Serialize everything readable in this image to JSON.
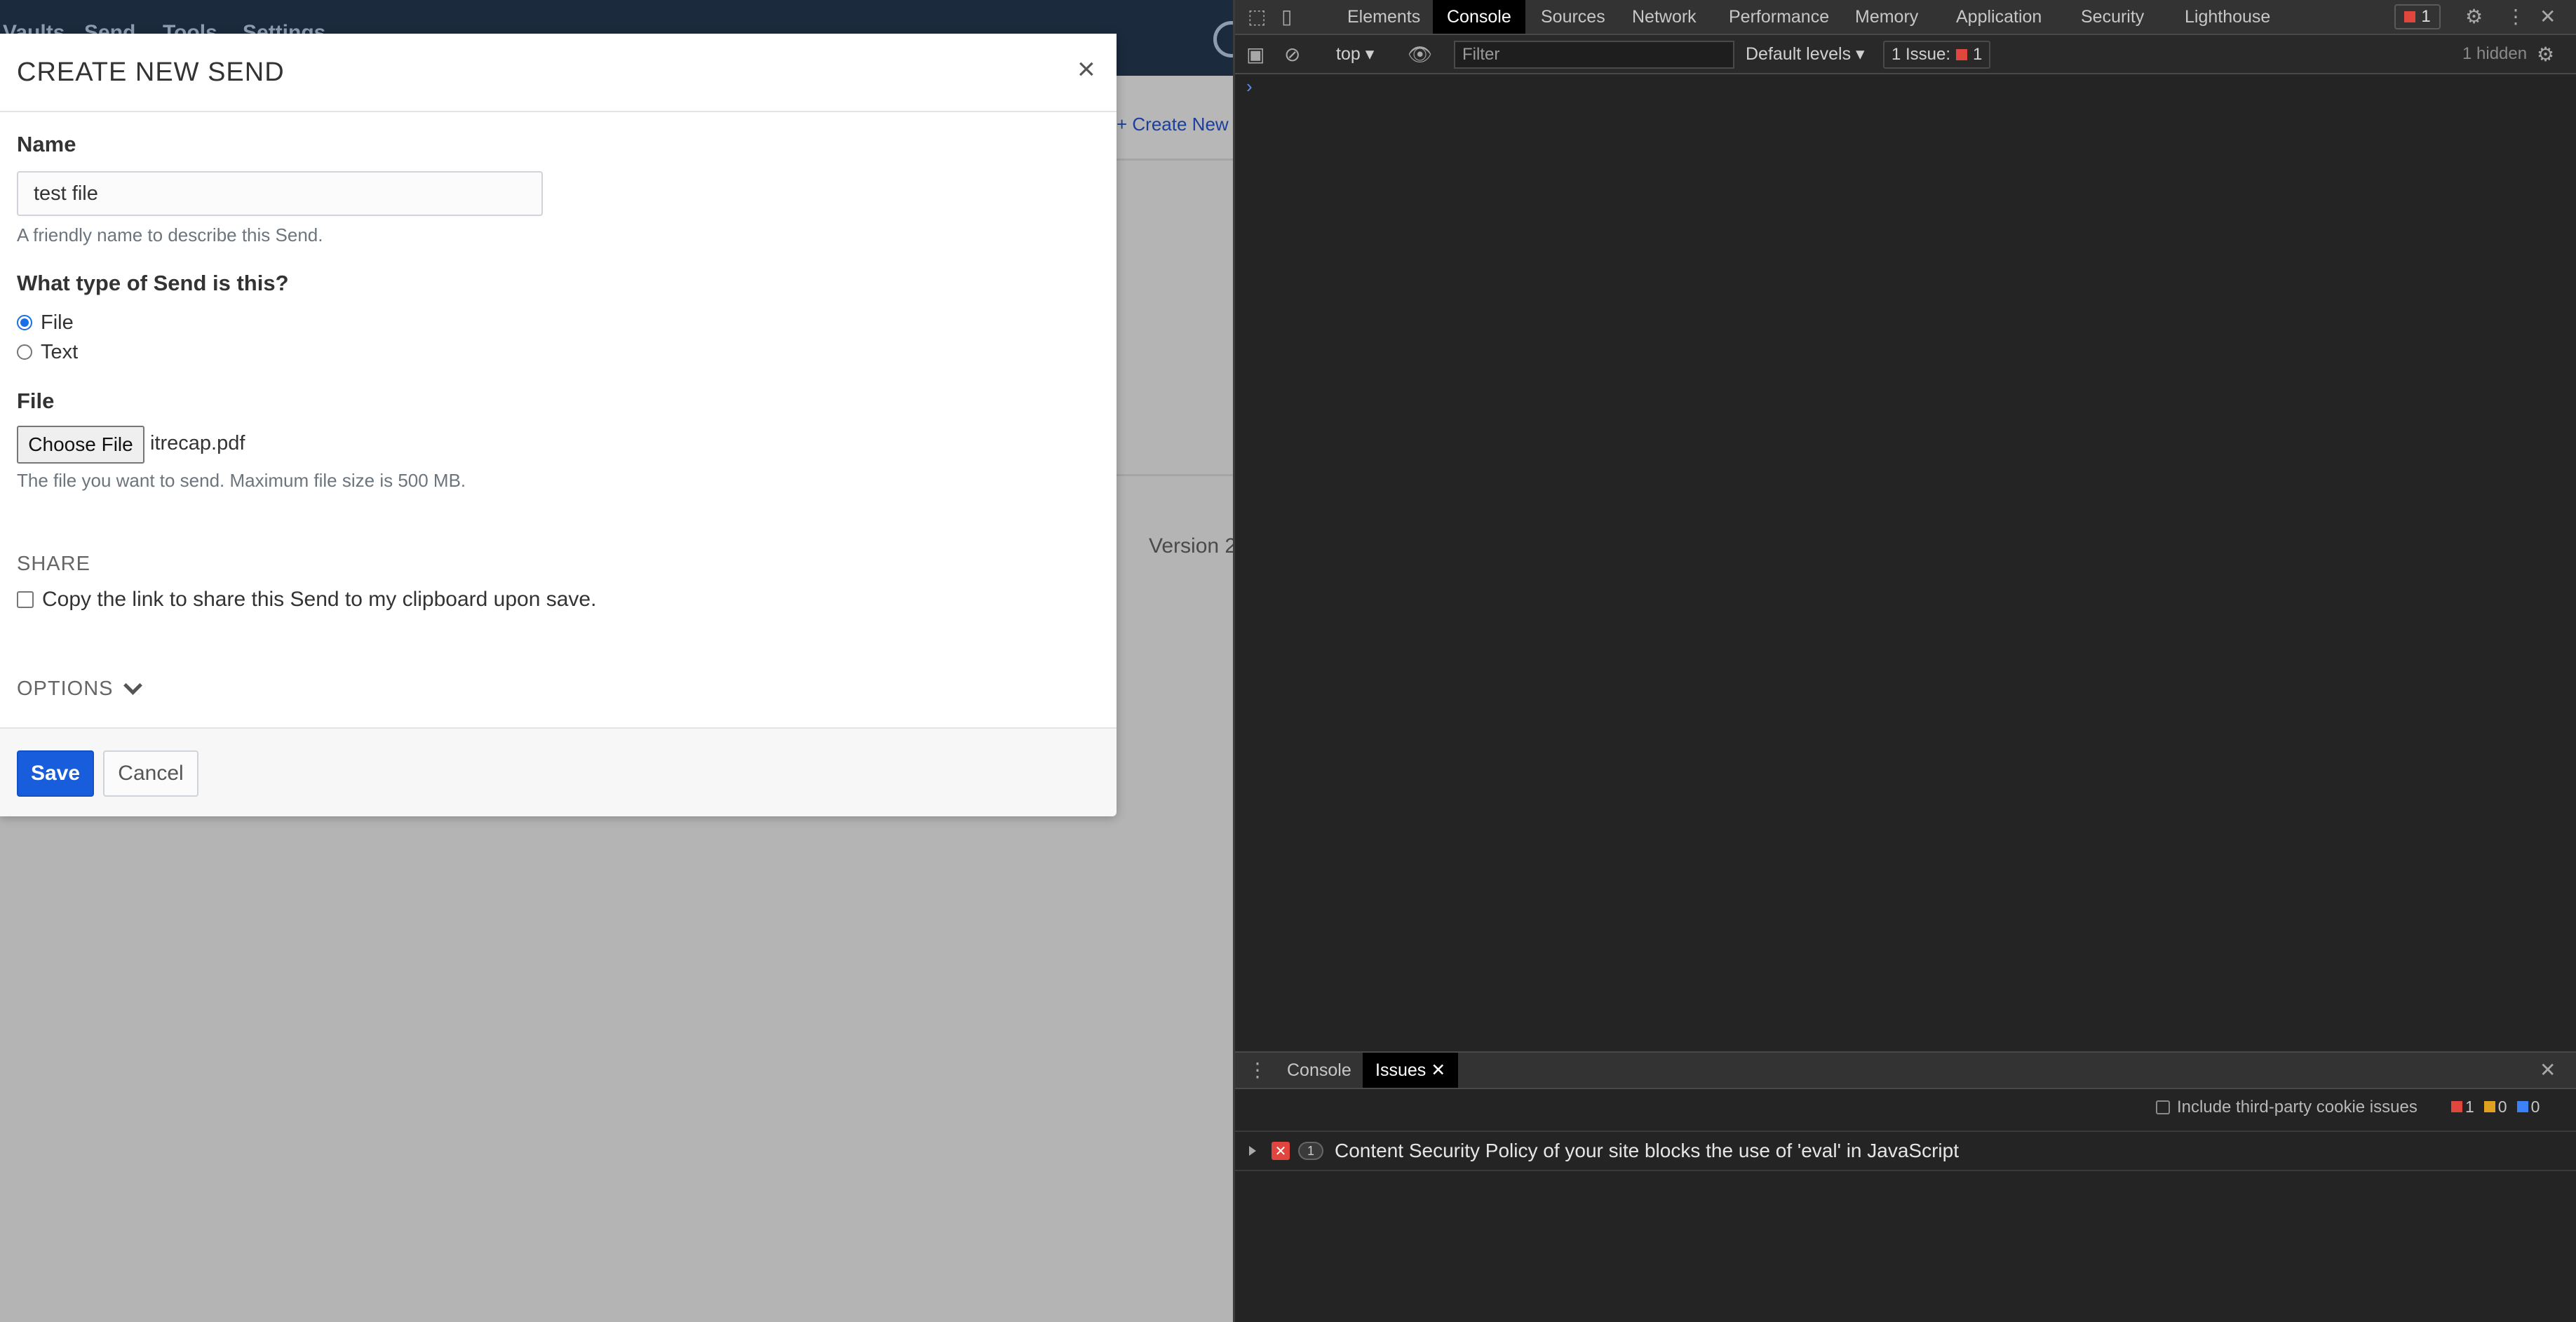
{
  "app": {
    "nav": [
      "Vaults",
      "Send",
      "Tools",
      "Settings"
    ],
    "create_send_link": "+ Create New Send",
    "version_text": "Version 2"
  },
  "modal": {
    "title": "CREATE NEW SEND",
    "close": "×",
    "name": {
      "label": "Name",
      "value": "test file",
      "help": "A friendly name to describe this Send."
    },
    "type": {
      "label": "What type of Send is this?",
      "options": [
        "File",
        "Text"
      ],
      "selected": "File"
    },
    "file": {
      "label": "File",
      "choose_button": "Choose File",
      "selected_file": "itrecap.pdf",
      "help": "The file you want to send. Maximum file size is 500 MB."
    },
    "share": {
      "heading": "SHARE",
      "copy_label": "Copy the link to share this Send to my clipboard upon save.",
      "copy_checked": false
    },
    "options_label": "OPTIONS",
    "save_label": "Save",
    "cancel_label": "Cancel"
  },
  "devtools": {
    "tabs": [
      "Elements",
      "Console",
      "Sources",
      "Network",
      "Performance",
      "Memory",
      "Application",
      "Security",
      "Lighthouse"
    ],
    "active_tab": "Console",
    "error_badge_count": "1",
    "toolbar": {
      "context": "top",
      "filter_placeholder": "Filter",
      "levels": "Default levels",
      "issues_label": "1 Issue:",
      "issues_count": "1",
      "hidden": "1 hidden"
    },
    "drawer": {
      "tabs": [
        "Console",
        "Issues"
      ],
      "active_tab": "Issues",
      "third_party_label": "Include third-party cookie issues",
      "counts": {
        "errors": "1",
        "warnings": "0",
        "info": "0"
      },
      "issue": {
        "count": "1",
        "text": "Content Security Policy of your site blocks the use of 'eval' in JavaScript"
      }
    },
    "colors": {
      "error": "#e0463e",
      "warning": "#e0a020",
      "info": "#3b82f6",
      "accent": "#175ddc"
    }
  }
}
